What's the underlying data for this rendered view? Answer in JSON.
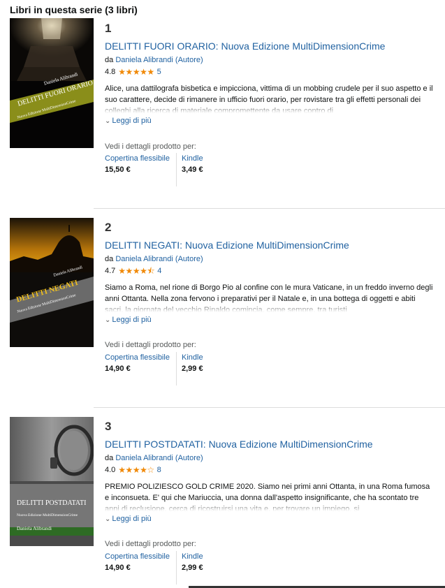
{
  "header": {
    "title": "Libri in questa serie (3 libri)"
  },
  "labels": {
    "by": "da",
    "more": "Leggi di più",
    "details": "Vedi i dettagli prodotto per:"
  },
  "colors": {
    "link": "#2162a1",
    "star": "#f08804"
  },
  "books": [
    {
      "number": "1",
      "title": "DELITTI FUORI ORARIO: Nuova Edizione MultiDimensionCrime",
      "author": "Daniela Alibrandi (Autore)",
      "rating": "4.8",
      "rating_value": 4.8,
      "stars_display": "★★★★★",
      "reviews": "5",
      "description": "Alice, una dattilografa bisbetica e impicciona, vittima di un mobbing crudele per il suo aspetto e il suo carattere, decide di rimanere in ufficio fuori orario, per rovistare tra gli effetti personali dei colleghi alla ricerca di materiale compromettente da usare contro di",
      "cover": {
        "author": "Daniela Alibrandi",
        "title": "DELITTI FUORI ORARIO",
        "subtitle": "Nuova Edizione MultiDimensionCrime"
      },
      "formats": [
        {
          "name": "Copertina flessibile",
          "price": "15,50 €"
        },
        {
          "name": "Kindle",
          "price": "3,49 €"
        }
      ]
    },
    {
      "number": "2",
      "title": "DELITTI NEGATI: Nuova Edizione MultiDimensionCrime",
      "author": "Daniela Alibrandi (Autore)",
      "rating": "4.7",
      "rating_value": 4.7,
      "stars_display": "★★★★⯪",
      "reviews": "4",
      "description": "Siamo a Roma, nel rione di Borgo Pio al confine con le mura Vaticane, in un freddo inverno degli anni Ottanta. Nella zona fervono i preparativi per il Natale e, in una bottega di oggetti e abiti sacri, la giornata del vecchio Rinaldo comincia, come sempre, tra turisti",
      "cover": {
        "author": "Daniela Alibrandi",
        "title": "DELITTI NEGATI",
        "subtitle": "Nuova Edizione MultiDimensionCrime"
      },
      "formats": [
        {
          "name": "Copertina flessibile",
          "price": "14,90 €"
        },
        {
          "name": "Kindle",
          "price": "2,99 €"
        }
      ]
    },
    {
      "number": "3",
      "title": "DELITTI POSTDATATI: Nuova Edizione MultiDimensionCrime",
      "author": "Daniela Alibrandi (Autore)",
      "rating": "4.0",
      "rating_value": 4.0,
      "stars_display": "★★★★☆",
      "reviews": "8",
      "description": "PREMIO POLIZIESCO GOLD CRIME 2020. Siamo nei primi anni Ottanta, in una Roma fumosa e inconsueta. E' qui che Mariuccia, una donna dall'aspetto insignificante, che ha scontato tre anni di reclusione, cerca di ricostruirsi una vita e, per trovare un impiego, si",
      "cover": {
        "author": "Daniela Alibrandi",
        "title": "DELITTI POSTDATATI",
        "subtitle": "Nuova Edizione MultiDimensionCrime"
      },
      "formats": [
        {
          "name": "Copertina flessibile",
          "price": "14,90 €"
        },
        {
          "name": "Kindle",
          "price": "2,99 €"
        }
      ]
    }
  ]
}
